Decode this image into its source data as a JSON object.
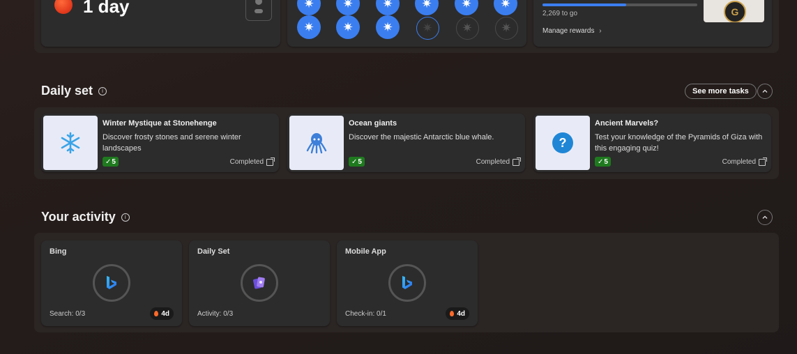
{
  "streak": {
    "text": "1 day",
    "apple_icon": "apple-icon",
    "phone_icon": "phone-icon"
  },
  "stars": {
    "row1": [
      "on",
      "on",
      "on",
      "on",
      "on",
      "on"
    ],
    "row2": [
      "on",
      "on",
      "on",
      "cur",
      "off",
      "off"
    ]
  },
  "rewards": {
    "progress_pct": 54,
    "to_go": "2,269 to go",
    "manage_label": "Manage rewards"
  },
  "daily_set": {
    "heading": "Daily set",
    "see_more": "See more tasks",
    "tasks": [
      {
        "title": "Winter Mystique at Stonehenge",
        "desc": "Discover frosty stones and serene winter landscapes",
        "points": "5",
        "status": "Completed",
        "icon": "snowflake-icon"
      },
      {
        "title": "Ocean giants",
        "desc": "Discover the majestic Antarctic blue whale.",
        "points": "5",
        "status": "Completed",
        "icon": "octopus-icon"
      },
      {
        "title": "Ancient Marvels?",
        "desc": "Test your knowledge of the Pyramids of Giza with this engaging quiz!",
        "points": "5",
        "status": "Completed",
        "icon": "question-icon"
      }
    ]
  },
  "activity": {
    "heading": "Your activity",
    "cards": [
      {
        "title": "Bing",
        "label": "Search: 0/3",
        "streak": "4d",
        "icon": "bing-icon"
      },
      {
        "title": "Daily Set",
        "label": "Activity: 0/3",
        "streak": "",
        "icon": "cards-icon"
      },
      {
        "title": "Mobile App",
        "label": "Check-in: 0/1",
        "streak": "4d",
        "icon": "bing-icon"
      }
    ]
  },
  "colors": {
    "accent": "#3b7ef0",
    "badge_green": "#1f7a1f",
    "flame": "#ff6a2a"
  }
}
